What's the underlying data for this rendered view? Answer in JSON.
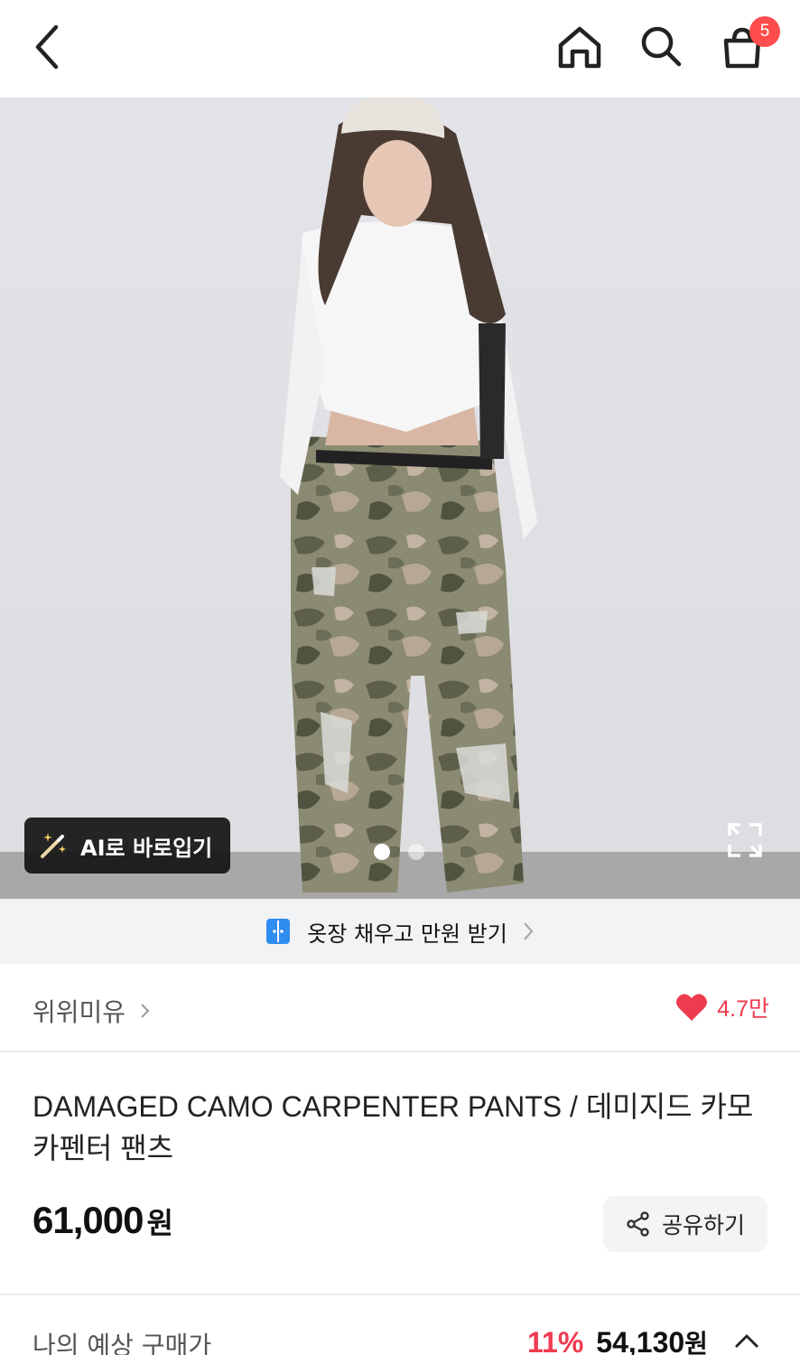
{
  "header": {
    "cart_count": "5",
    "icons": [
      "chevron-left-icon",
      "home-icon",
      "search-icon",
      "shopping-bag-icon"
    ]
  },
  "hero": {
    "ai_try_on_label": "AI로 바로입기",
    "slide_count": 2,
    "active_slide": 1
  },
  "promo": {
    "label": "옷장 채우고 만원 받기"
  },
  "brand": {
    "name": "위위미유",
    "like_count": "4.7만"
  },
  "product": {
    "title": "DAMAGED CAMO CARPENTER PANTS / 데미지드 카모 카펜터 팬츠",
    "price": "61,000",
    "price_unit": "원",
    "share_label": "공유하기"
  },
  "estimate": {
    "label": "나의 예상 구매가",
    "discount": "11%",
    "price": "54,130",
    "unit": "원"
  },
  "colors": {
    "accent_red": "#ef3b4f",
    "badge_red": "#ff4d4d",
    "promo_blue": "#2f8cf0"
  }
}
